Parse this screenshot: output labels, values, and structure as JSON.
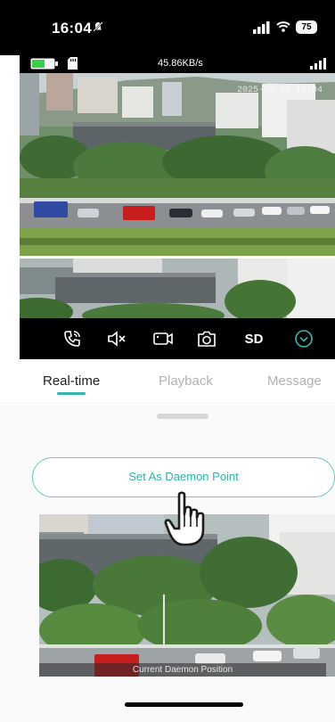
{
  "status_bar": {
    "time": "16:04",
    "battery_level": "75",
    "icons": [
      "silent-bell-icon",
      "cellular-signal-icon",
      "wifi-icon",
      "battery-icon"
    ]
  },
  "camera_info": {
    "data_rate": "45.86KB/s",
    "camera_battery_color": "#3ad04a",
    "icons": [
      "camera-battery-icon",
      "sd-card-icon",
      "camera-signal-icon"
    ]
  },
  "video": {
    "timestamp": "2025-03-06 16:04"
  },
  "toolbar": {
    "items": [
      {
        "icon": "call-icon"
      },
      {
        "icon": "speaker-mute-icon"
      },
      {
        "icon": "record-icon"
      },
      {
        "icon": "snapshot-icon"
      },
      {
        "label": "SD"
      },
      {
        "icon": "chevron-down-circle-icon"
      }
    ],
    "accent_color": "#34b8ad"
  },
  "tabs": [
    {
      "label": "Real-time",
      "active": true
    },
    {
      "label": "Playback",
      "active": false
    },
    {
      "label": "Message",
      "active": false
    }
  ],
  "daemon": {
    "button_label": "Set As Daemon Point",
    "preview_caption": "Current Daemon Position"
  }
}
